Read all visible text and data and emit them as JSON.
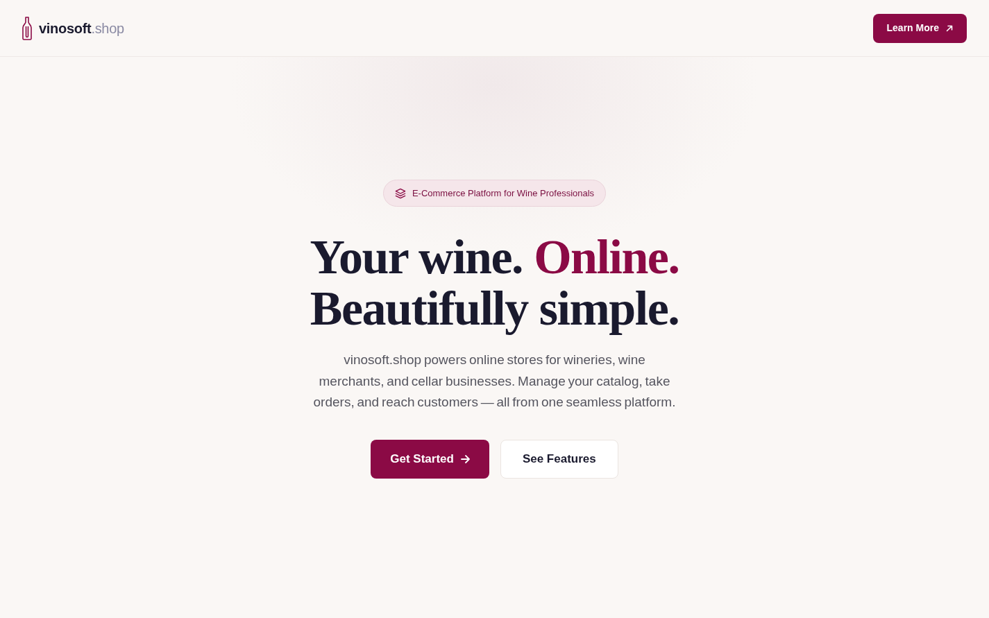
{
  "header": {
    "logo": {
      "name": "vinosoft",
      "suffix": ".shop"
    },
    "cta": {
      "label": "Learn More"
    }
  },
  "hero": {
    "badge": {
      "label": "E-Commerce Platform for Wine Professionals"
    },
    "headline": {
      "lines": [
        [
          {
            "text": "Your wine.",
            "accent": false
          },
          {
            "text": "Online.",
            "accent": true
          }
        ],
        [
          {
            "text": "Beautifully simple.",
            "accent": false
          }
        ]
      ]
    },
    "description": "vinosoft.shop powers online stores for wineries, wine merchants, and cellar businesses. Manage your catalog, take orders, and reach customers — all from one seamless platform.",
    "buttons": [
      {
        "label": "Get Started",
        "kind": "primary"
      },
      {
        "label": "See Features",
        "kind": "secondary"
      }
    ]
  }
}
